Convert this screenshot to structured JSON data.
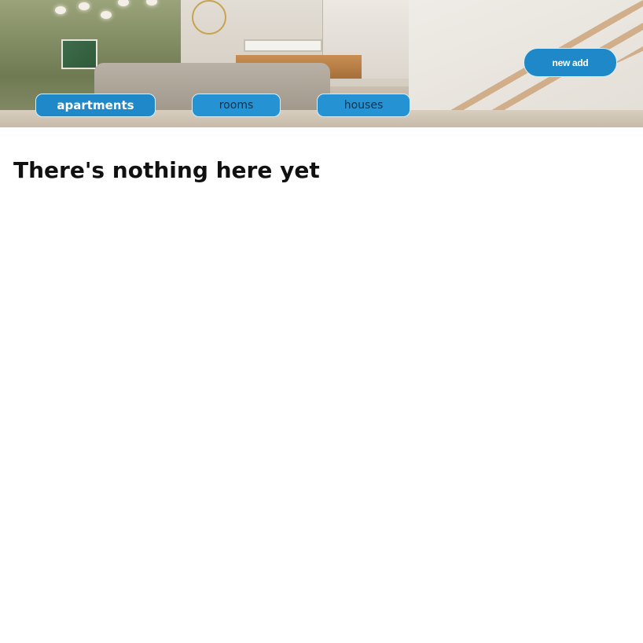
{
  "hero": {
    "image_name": "living-room-photo",
    "tabs": [
      {
        "label": "apartments",
        "active": true
      },
      {
        "label": "rooms",
        "active": false
      },
      {
        "label": "houses",
        "active": false
      }
    ],
    "new_add_label": "new add"
  },
  "main": {
    "empty_message": "There's nothing here yet"
  },
  "colors": {
    "button_blue": "#1f88c9",
    "button_border": "#d8eef9",
    "text_dark": "#111111",
    "background": "#ffffff"
  }
}
